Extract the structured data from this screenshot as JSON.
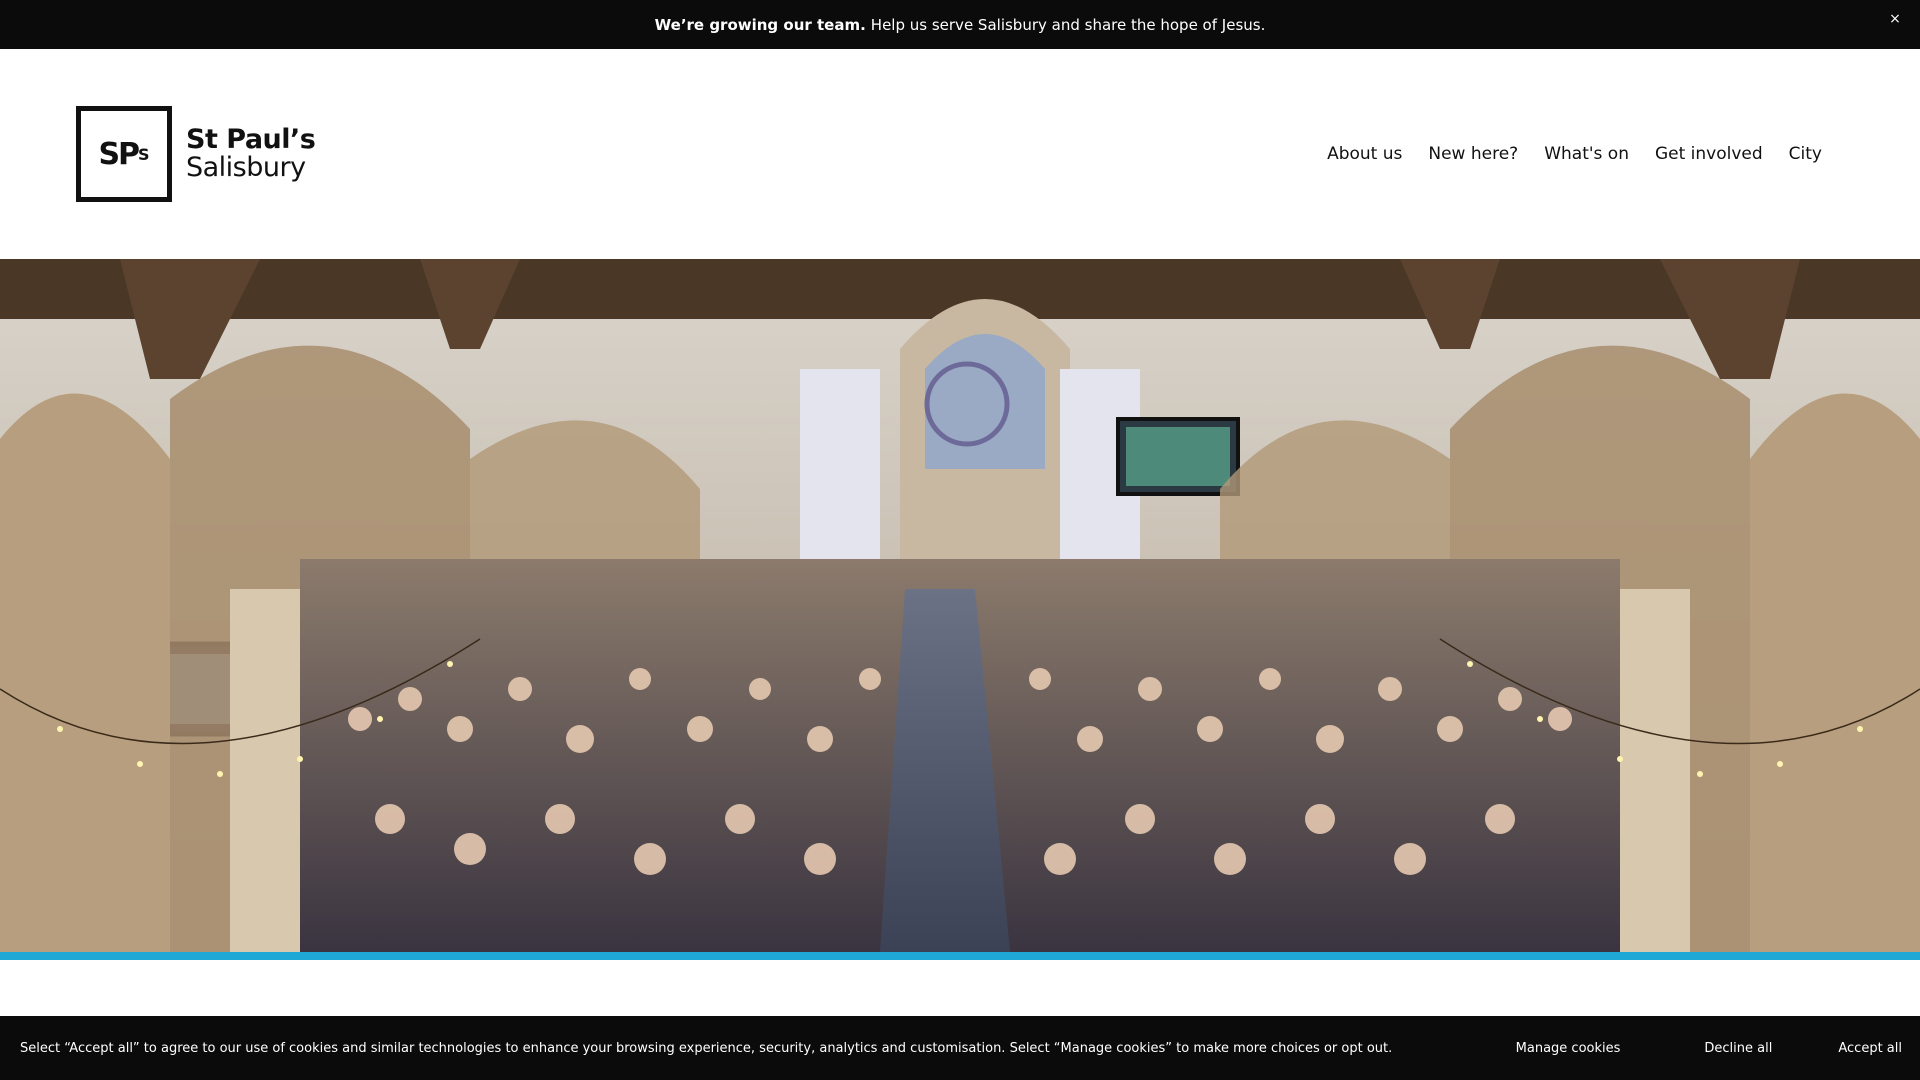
{
  "announcement": {
    "bold_text": "We’re growing our team.",
    "text": "Help us serve Salisbury and share the hope of Jesus.",
    "close_label": "×"
  },
  "logo": {
    "mark": "SP",
    "mark_sup": "S",
    "line1": "St Paul’s",
    "line2": "Salisbury"
  },
  "nav": {
    "items": [
      {
        "label": "About us"
      },
      {
        "label": "New here?"
      },
      {
        "label": "What's on"
      },
      {
        "label": "Get involved"
      },
      {
        "label": "City"
      }
    ]
  },
  "hero": {
    "image": "church-congregation-photo"
  },
  "colors": {
    "accent_bar": "#1fa8d6",
    "bar_background": "#0b0b0b"
  },
  "cookie": {
    "text": "Select “Accept all” to agree to our use of cookies and similar technologies to enhance your browsing experience, security, analytics and customisation. Select “Manage cookies” to make more choices or opt out.",
    "manage_label": "Manage cookies",
    "decline_label": "Decline all",
    "accept_label": "Accept all"
  }
}
